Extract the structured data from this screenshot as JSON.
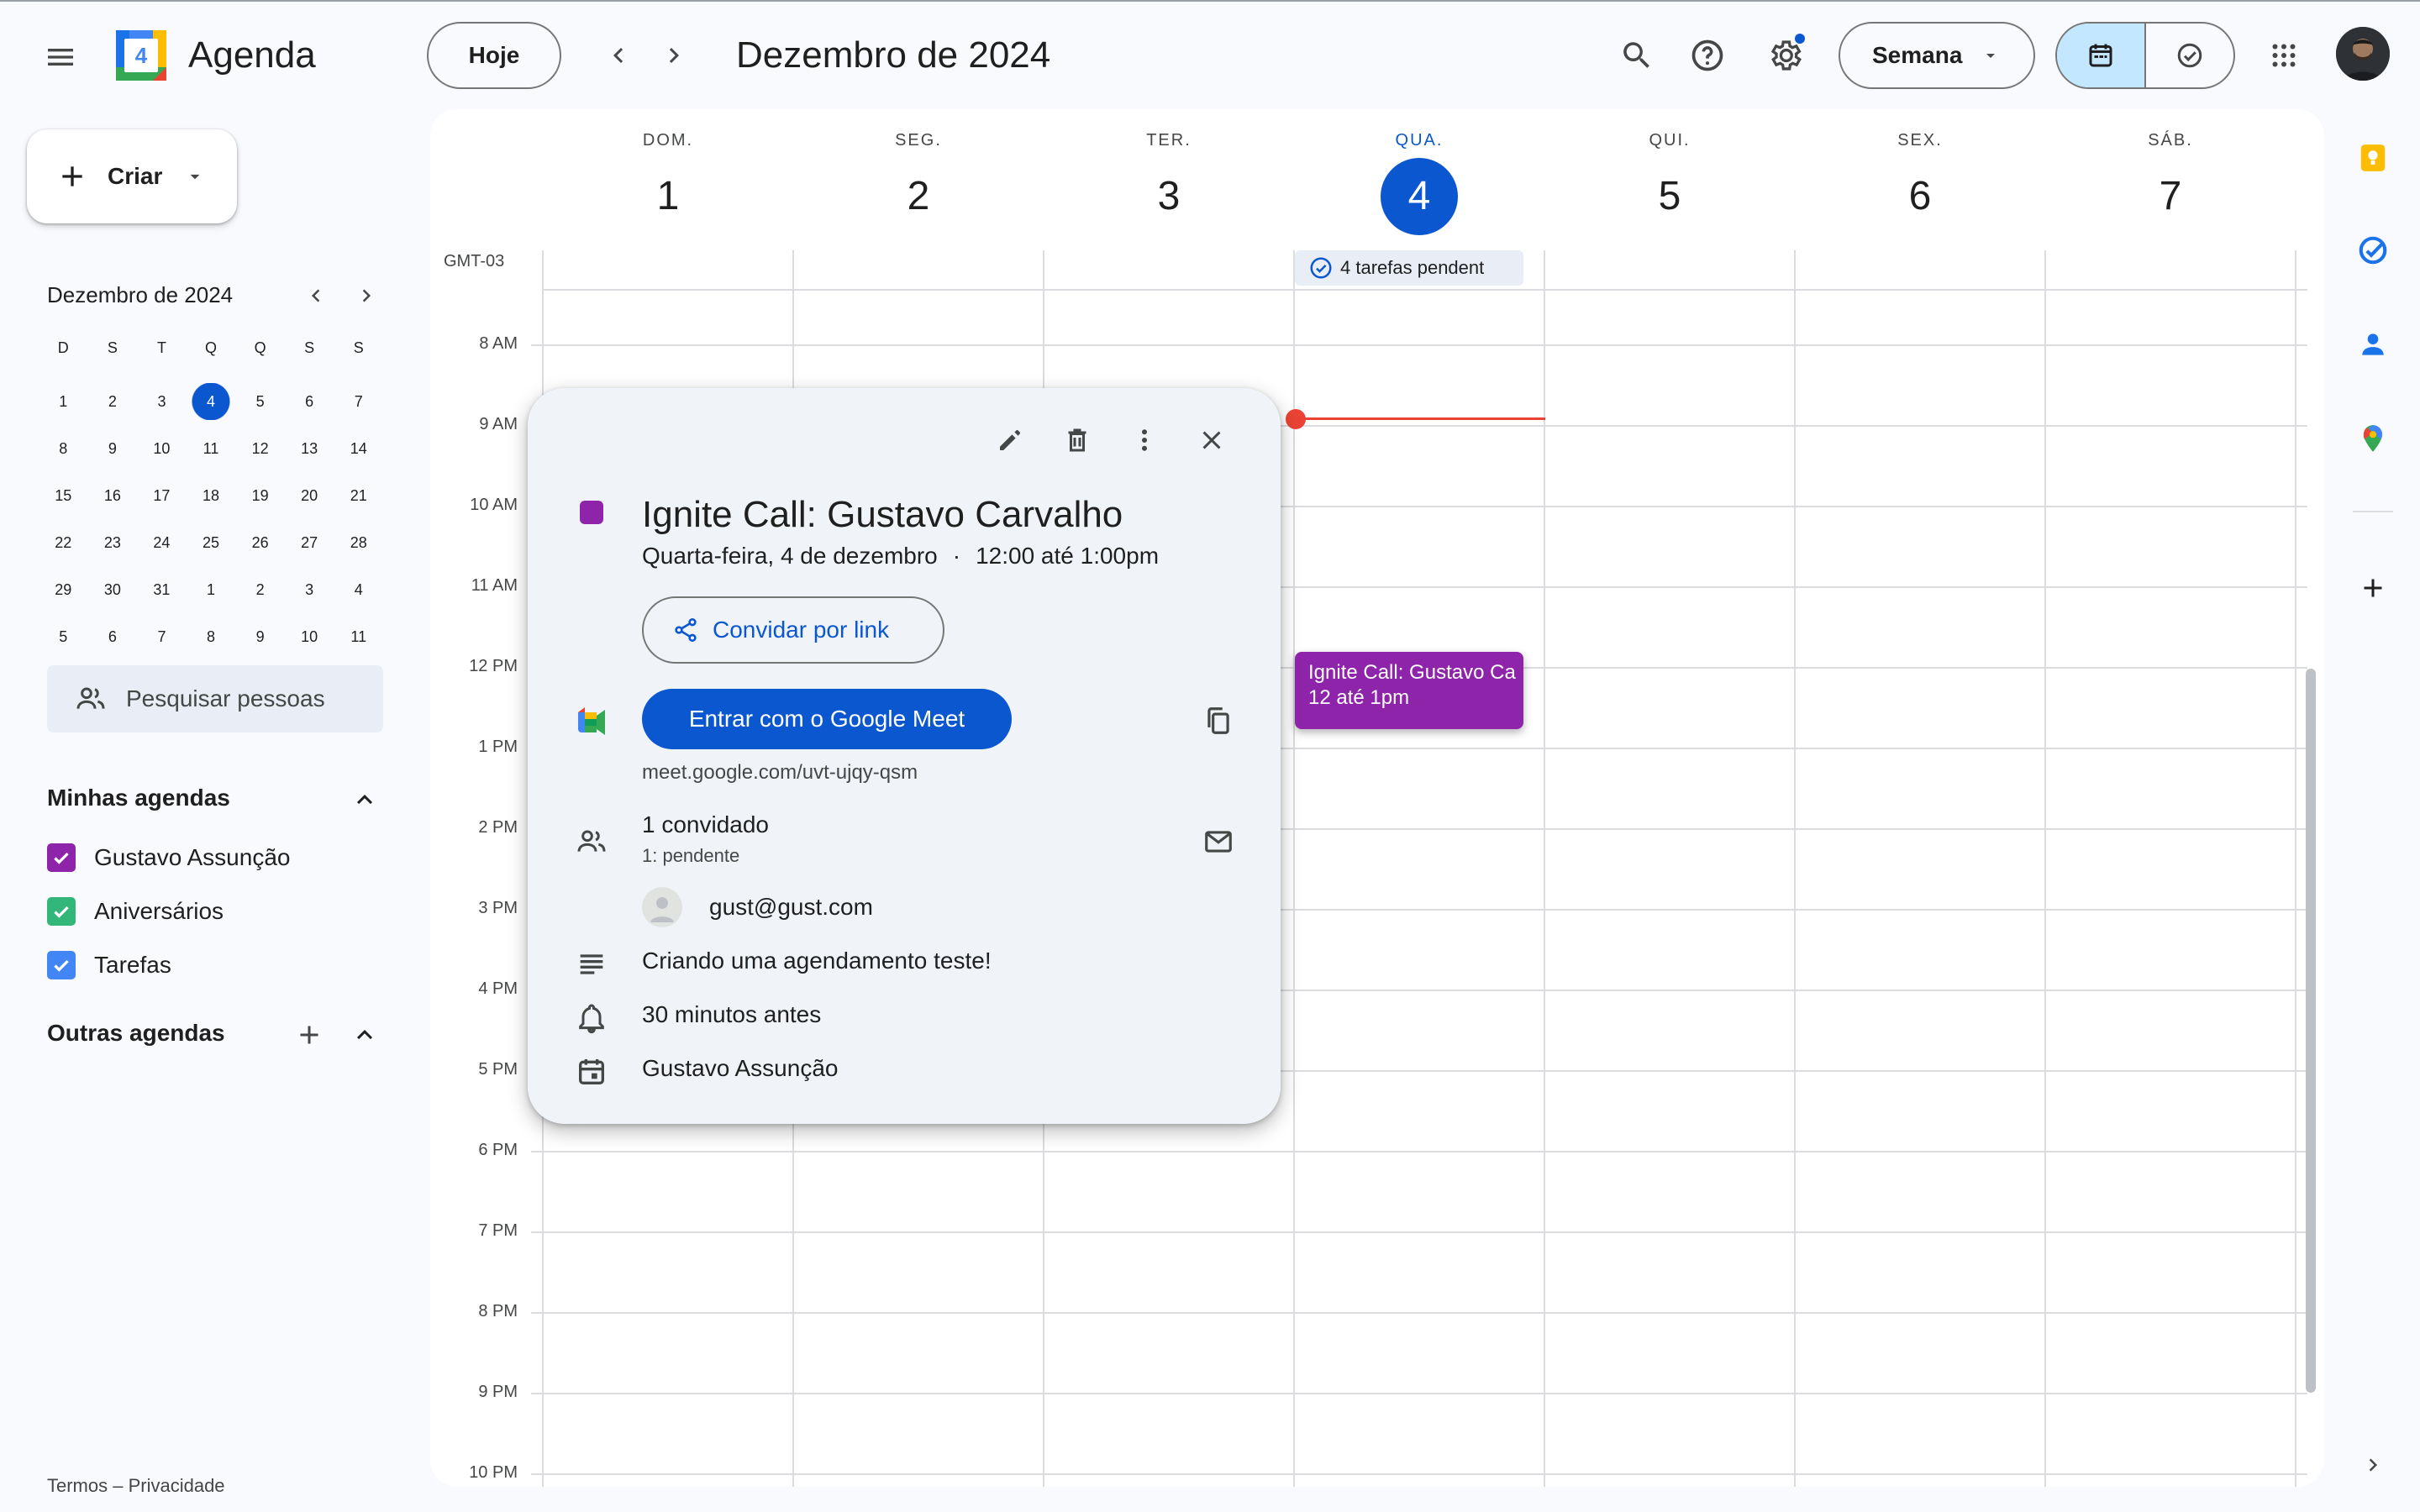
{
  "header": {
    "app_name": "Agenda",
    "logo_number": "4",
    "today_button": "Hoje",
    "month_title": "Dezembro de 2024",
    "view_selector": "Semana"
  },
  "sidebar": {
    "create_button": "Criar",
    "mini_calendar": {
      "title": "Dezembro de 2024",
      "weekdays": [
        "D",
        "S",
        "T",
        "Q",
        "Q",
        "S",
        "S"
      ],
      "weeks": [
        [
          "1",
          "2",
          "3",
          "4",
          "5",
          "6",
          "7"
        ],
        [
          "8",
          "9",
          "10",
          "11",
          "12",
          "13",
          "14"
        ],
        [
          "15",
          "16",
          "17",
          "18",
          "19",
          "20",
          "21"
        ],
        [
          "22",
          "23",
          "24",
          "25",
          "26",
          "27",
          "28"
        ],
        [
          "29",
          "30",
          "31",
          "1",
          "2",
          "3",
          "4"
        ],
        [
          "5",
          "6",
          "7",
          "8",
          "9",
          "10",
          "11"
        ]
      ],
      "selected_day": "4"
    },
    "search_people_placeholder": "Pesquisar pessoas",
    "my_calendars_title": "Minhas agendas",
    "my_calendars": [
      {
        "label": "Gustavo Assunção",
        "color": "#8e24aa"
      },
      {
        "label": "Aniversários",
        "color": "#33b679"
      },
      {
        "label": "Tarefas",
        "color": "#4285f4"
      }
    ],
    "other_calendars_title": "Outras agendas",
    "footer": "Termos – Privacidade"
  },
  "week": {
    "timezone": "GMT-03",
    "days": [
      {
        "name": "DOM.",
        "num": "1"
      },
      {
        "name": "SEG.",
        "num": "2"
      },
      {
        "name": "TER.",
        "num": "3"
      },
      {
        "name": "QUA.",
        "num": "4",
        "today": true
      },
      {
        "name": "QUI.",
        "num": "5"
      },
      {
        "name": "SEX.",
        "num": "6"
      },
      {
        "name": "SÁB.",
        "num": "7"
      }
    ],
    "tasks_chip": "4 tarefas pendent",
    "hours": [
      "8 AM",
      "9 AM",
      "10 AM",
      "11 AM",
      "12 PM",
      "1 PM",
      "2 PM",
      "3 PM",
      "4 PM",
      "5 PM",
      "6 PM",
      "7 PM",
      "8 PM",
      "9 PM",
      "10 PM"
    ],
    "event": {
      "title": "Ignite Call: Gustavo Ca",
      "time": "12 até 1pm",
      "color": "#8e24aa"
    }
  },
  "popup": {
    "title": "Ignite Call: Gustavo Carvalho",
    "date": "Quarta-feira, 4 de dezembro",
    "separator": "·",
    "time": "12:00 até 1:00pm",
    "invite_link_button": "Convidar por link",
    "meet_button": "Entrar com o Google Meet",
    "meet_url": "meet.google.com/uvt-ujqy-qsm",
    "guests_count": "1 convidado",
    "guests_status": "1: pendente",
    "guest_email": "gust@gust.com",
    "description": "Criando uma agendamento teste!",
    "reminder": "30 minutos antes",
    "calendar": "Gustavo Assunção",
    "color": "#8e24aa"
  },
  "colors": {
    "accent": "#0b57d0",
    "today": "#0b57d0",
    "now_line": "#ea4335"
  }
}
